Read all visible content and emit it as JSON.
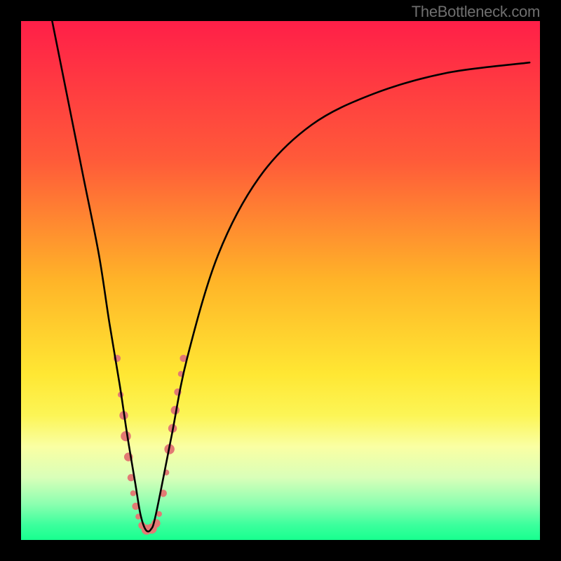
{
  "watermark": "TheBottleneck.com",
  "chart_data": {
    "type": "line",
    "title": "",
    "xlabel": "",
    "ylabel": "",
    "xlim": [
      0,
      100
    ],
    "ylim": [
      0,
      100
    ],
    "gradient_stops": [
      {
        "offset": 0,
        "color": "#ff1f48"
      },
      {
        "offset": 27,
        "color": "#ff5b39"
      },
      {
        "offset": 50,
        "color": "#ffb428"
      },
      {
        "offset": 68,
        "color": "#ffe733"
      },
      {
        "offset": 76,
        "color": "#fcf556"
      },
      {
        "offset": 82,
        "color": "#faffa3"
      },
      {
        "offset": 88,
        "color": "#d9ffb9"
      },
      {
        "offset": 93,
        "color": "#8dffb0"
      },
      {
        "offset": 97,
        "color": "#3dff9d"
      },
      {
        "offset": 100,
        "color": "#17ff8f"
      }
    ],
    "series": [
      {
        "name": "bottleneck-curve",
        "color": "#000000",
        "x": [
          6,
          9,
          12,
          15,
          17,
          19,
          20.5,
          22,
          23,
          24,
          25,
          26,
          29,
          32,
          38,
          46,
          56,
          68,
          82,
          98
        ],
        "y": [
          100,
          85,
          70,
          55,
          42,
          30,
          20,
          11,
          5,
          2,
          2,
          5,
          20,
          35,
          55,
          70,
          80,
          86,
          90,
          92
        ]
      }
    ],
    "markers": {
      "name": "highlight-dots",
      "color": "#e27a74",
      "points": [
        {
          "x": 18.5,
          "y": 35,
          "r": 5
        },
        {
          "x": 19.2,
          "y": 28,
          "r": 4
        },
        {
          "x": 19.8,
          "y": 24,
          "r": 6
        },
        {
          "x": 20.2,
          "y": 20,
          "r": 7
        },
        {
          "x": 20.7,
          "y": 16,
          "r": 6
        },
        {
          "x": 21.2,
          "y": 12,
          "r": 5
        },
        {
          "x": 21.6,
          "y": 9,
          "r": 4
        },
        {
          "x": 22.1,
          "y": 6.5,
          "r": 5
        },
        {
          "x": 22.6,
          "y": 4.5,
          "r": 4
        },
        {
          "x": 23.3,
          "y": 2.8,
          "r": 5
        },
        {
          "x": 24.2,
          "y": 2.0,
          "r": 7
        },
        {
          "x": 25.2,
          "y": 2.2,
          "r": 7
        },
        {
          "x": 26.0,
          "y": 3.2,
          "r": 6
        },
        {
          "x": 26.6,
          "y": 5.0,
          "r": 4
        },
        {
          "x": 27.4,
          "y": 9.0,
          "r": 5
        },
        {
          "x": 28.0,
          "y": 13.0,
          "r": 4
        },
        {
          "x": 28.6,
          "y": 17.5,
          "r": 7
        },
        {
          "x": 29.2,
          "y": 21.5,
          "r": 6
        },
        {
          "x": 29.7,
          "y": 25.0,
          "r": 6
        },
        {
          "x": 30.2,
          "y": 28.5,
          "r": 5
        },
        {
          "x": 30.8,
          "y": 32.0,
          "r": 4
        },
        {
          "x": 31.3,
          "y": 35.0,
          "r": 5
        }
      ]
    }
  }
}
